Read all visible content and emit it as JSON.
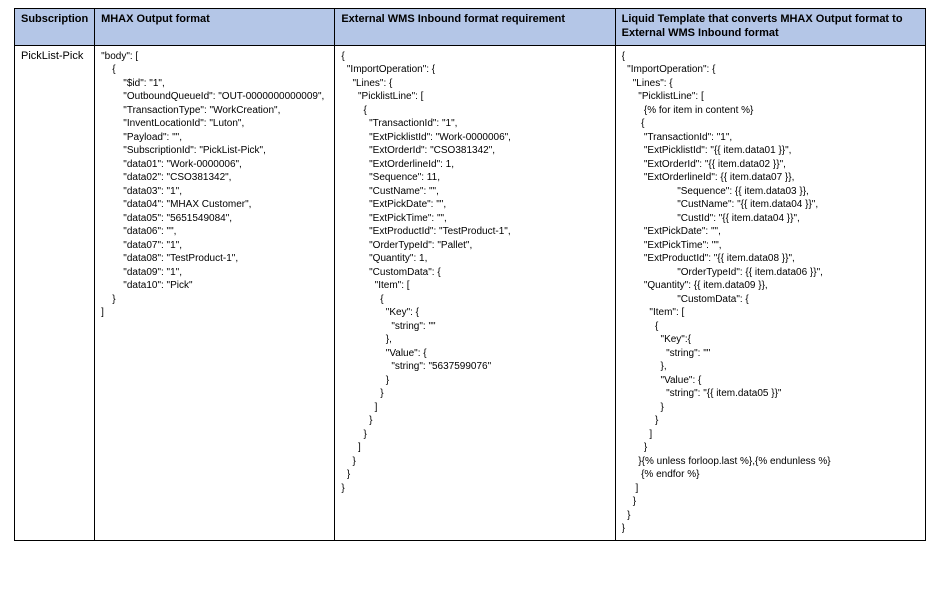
{
  "headers": {
    "col1": "Subscription",
    "col2": "MHAX Output format",
    "col3": "External WMS Inbound format requirement",
    "col4": "Liquid Template that converts MHAX Output format to External WMS Inbound format"
  },
  "row": {
    "subscription": "PickList-Pick",
    "mhax_output": "\"body\": [\n    {\n        \"$id\": \"1\",\n        \"OutboundQueueId\": \"OUT-0000000000009\",\n        \"TransactionType\": \"WorkCreation\",\n        \"InventLocationId\": \"Luton\",\n        \"Payload\": \"\",\n        \"SubscriptionId\": \"PickList-Pick\",\n        \"data01\": \"Work-0000006\",\n        \"data02\": \"CSO381342\",\n        \"data03\": \"1\",\n        \"data04\": \"MHAX Customer\",\n        \"data05\": \"5651549084\",\n        \"data06\": \"\",\n        \"data07\": \"1\",\n        \"data08\": \"TestProduct-1\",\n        \"data09\": \"1\",\n        \"data10\": \"Pick\"\n    }\n]",
    "external_wms": "{\n  \"ImportOperation\": {\n    \"Lines\": {\n      \"PicklistLine\": [\n        {\n          \"TransactionId\": \"1\",\n          \"ExtPicklistId\": \"Work-0000006\",\n          \"ExtOrderId\": \"CSO381342\",\n          \"ExtOrderlineId\": 1,\n          \"Sequence\": 11,\n          \"CustName\": \"\",\n          \"ExtPickDate\": \"\",\n          \"ExtPickTime\": \"\",\n          \"ExtProductId\": \"TestProduct-1\",\n          \"OrderTypeId\": \"Pallet\",\n          \"Quantity\": 1,\n          \"CustomData\": {\n            \"Item\": [\n              {\n                \"Key\": {\n                  \"string\": \"\"\n                },\n                \"Value\": {\n                  \"string\": \"5637599076\"\n                }\n              }\n            ]\n          }\n        }\n      ]\n    }\n  }\n}",
    "liquid_template": "{\n  \"ImportOperation\": {\n    \"Lines\": {\n      \"PicklistLine\": [\n        {% for item in content %}\n       {\n        \"TransactionId\": \"1\",\n        \"ExtPicklistId\": \"{{ item.data01 }}\",\n        \"ExtOrderId\": \"{{ item.data02 }}\",\n        \"ExtOrderlineId\": {{ item.data07 }},\n                    \"Sequence\": {{ item.data03 }},\n                    \"CustName\": \"{{ item.data04 }}\",\n                    \"CustId\": \"{{ item.data04 }}\",\n        \"ExtPickDate\": \"\",\n        \"ExtPickTime\": \"\",\n        \"ExtProductId\": \"{{ item.data08 }}\",\n                    \"OrderTypeId\": {{ item.data06 }}\",\n        \"Quantity\": {{ item.data09 }},\n                    \"CustomData\": {\n          \"Item\": [\n            {\n              \"Key\":{\n                \"string\": \"\"\n              },\n              \"Value\": {\n                \"string\": \"{{ item.data05 }}\"\n              }\n            }\n          ]\n        }\n      }{% unless forloop.last %},{% endunless %}\n       {% endfor %}\n     ]\n    }\n  }\n}"
  }
}
